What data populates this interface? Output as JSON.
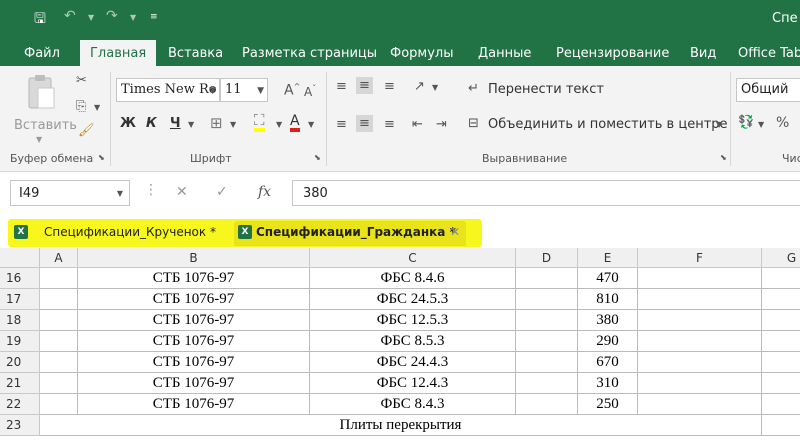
{
  "titlebar": {
    "title": "Спе"
  },
  "tabs": {
    "file": "Файл",
    "home": "Главная",
    "insert": "Вставка",
    "layout": "Разметка страницы",
    "formulas": "Формулы",
    "data": "Данные",
    "review": "Рецензирование",
    "view": "Вид",
    "office": "Office Tab"
  },
  "ribbon": {
    "paste_label": "Вставить",
    "clipboard_label": "Буфер обмена",
    "font_name": "Times New Ro",
    "font_size": "11",
    "bold": "Ж",
    "italic": "К",
    "underline": "Ч",
    "font_label": "Шрифт",
    "wrap_text": "Перенести текст",
    "merge_center": "Объединить и поместить в центре",
    "alignment_label": "Выравнивание",
    "number_format": "Общий",
    "number_label_partial": "Чис"
  },
  "formula_bar": {
    "name_box": "I49",
    "fx": "fx",
    "value": "380"
  },
  "workbook_tabs": [
    {
      "label": "Спецификации_Крученок *"
    },
    {
      "label": "Спецификации_Гражданка *"
    }
  ],
  "grid": {
    "columns": [
      "A",
      "B",
      "C",
      "D",
      "E",
      "F",
      "G"
    ],
    "rows": [
      {
        "num": "16",
        "b": "СТБ 1076-97",
        "c": "ФБС 8.4.6",
        "e": "470"
      },
      {
        "num": "17",
        "b": "СТБ 1076-97",
        "c": "ФБС 24.5.3",
        "e": "810"
      },
      {
        "num": "18",
        "b": "СТБ 1076-97",
        "c": "ФБС 12.5.3",
        "e": "380"
      },
      {
        "num": "19",
        "b": "СТБ 1076-97",
        "c": "ФБС 8.5.3",
        "e": "290"
      },
      {
        "num": "20",
        "b": "СТБ 1076-97",
        "c": "ФБС 24.4.3",
        "e": "670"
      },
      {
        "num": "21",
        "b": "СТБ 1076-97",
        "c": "ФБС 12.4.3",
        "e": "310"
      },
      {
        "num": "22",
        "b": "СТБ 1076-97",
        "c": "ФБС 8.4.3",
        "e": "250"
      }
    ],
    "merged_row": {
      "num": "23",
      "text": "Плиты перекрытия"
    }
  },
  "colors": {
    "excel_green": "#217346",
    "highlight": "#f7f71e"
  }
}
